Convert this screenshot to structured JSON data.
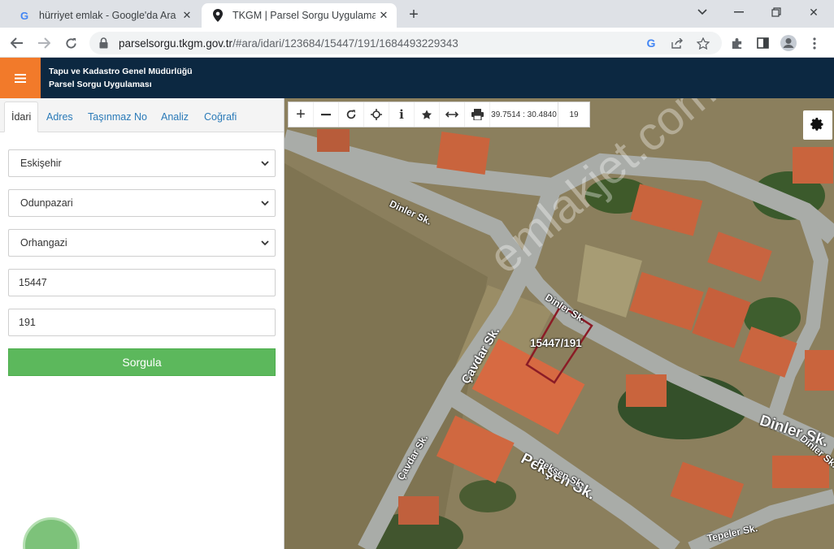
{
  "browser": {
    "tabs": [
      {
        "title": "hürriyet emlak - Google'da Ara",
        "icon": "google-g-icon",
        "active": false
      },
      {
        "title": "TKGM | Parsel Sorgu Uygulaması",
        "icon": "map-pin-icon",
        "active": true
      }
    ],
    "url_host": "parselsorgu.tkgm.gov.tr",
    "url_path": "/#ara/idari/123684/15447/191/1684493229343"
  },
  "app": {
    "title_line1": "Tapu ve Kadastro Genel Müdürlüğü",
    "title_line2": "Parsel Sorgu Uygulaması",
    "header_color": "#0c2841",
    "accent_color": "#f27a2a"
  },
  "panel": {
    "tabs": [
      "İdari",
      "Adres",
      "Taşınmaz No",
      "Analiz",
      "Coğrafi"
    ],
    "active_tab": "İdari",
    "il": "Eskişehir",
    "ilce": "Odunpazari",
    "mahalle": "Orhangazi",
    "ada": "15447",
    "parsel": "191",
    "submit_label": "Sorgula",
    "submit_color": "#5cb85c"
  },
  "map": {
    "coordinates": "39.7514 : 30.4840",
    "zoom": "19",
    "parcel_label": "15447/191",
    "watermark": "emlakjet.com",
    "streets": [
      "Dinler Sk.",
      "Dinler Sk.",
      "Çavdar Sk.",
      "Çavdar Sk.",
      "Dinler Sk.",
      "Dinler Sk.",
      "Pekşen Sk.",
      "Pekşen Sk.",
      "Tepeler Sk."
    ]
  }
}
